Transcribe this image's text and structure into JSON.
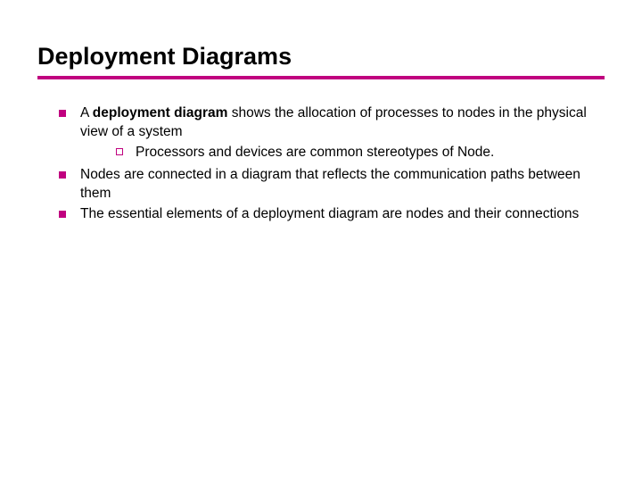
{
  "title": "Deployment Diagrams",
  "items": [
    {
      "pre": "A ",
      "bold": "deployment diagram",
      "post": " shows the allocation of processes to nodes in the physical view of a system",
      "sub": "Processors and devices are common stereotypes of Node."
    },
    {
      "pre": "",
      "bold": "",
      "post": "Nodes are connected in a diagram that reflects the communication paths between them"
    },
    {
      "pre": "",
      "bold": "",
      "post": "The essential elements of a deployment diagram are nodes and their connections"
    }
  ]
}
